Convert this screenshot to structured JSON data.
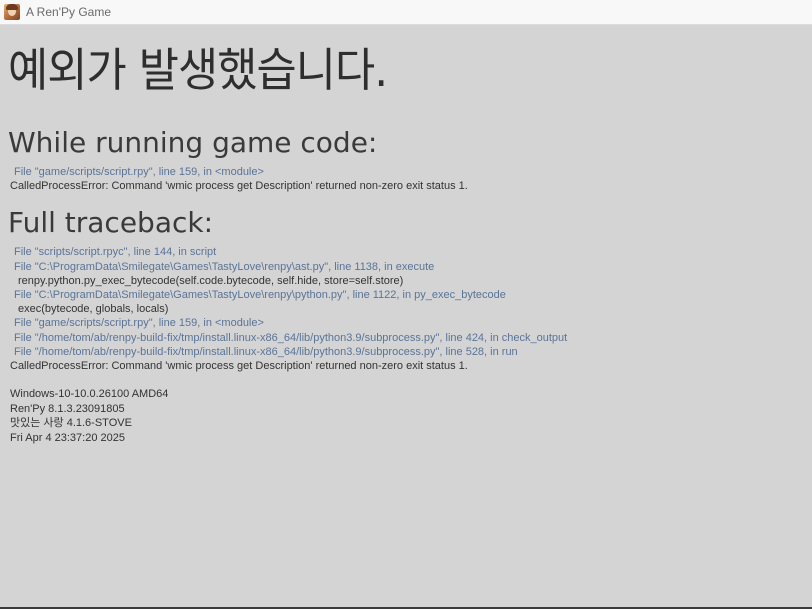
{
  "window": {
    "title": "A Ren'Py Game"
  },
  "error": {
    "heading": "예외가 발생했습니다.",
    "running_heading": "While running game code:",
    "running_lines": [
      {
        "kind": "file",
        "text": "File \"game/scripts/script.rpy\", line 159, in <module>"
      },
      {
        "kind": "msg",
        "text": "CalledProcessError: Command 'wmic process get Description' returned non-zero exit status 1."
      }
    ],
    "traceback_heading": "Full traceback:",
    "traceback_lines": [
      {
        "kind": "file",
        "text": "File \"scripts/script.rpyc\", line 144, in script"
      },
      {
        "kind": "file",
        "text": "File \"C:\\ProgramData\\Smilegate\\Games\\TastyLove\\renpy\\ast.py\", line 1138, in execute"
      },
      {
        "kind": "code",
        "text": "renpy.python.py_exec_bytecode(self.code.bytecode, self.hide, store=self.store)"
      },
      {
        "kind": "file",
        "text": "File \"C:\\ProgramData\\Smilegate\\Games\\TastyLove\\renpy\\python.py\", line 1122, in py_exec_bytecode"
      },
      {
        "kind": "code",
        "text": "exec(bytecode, globals, locals)"
      },
      {
        "kind": "file",
        "text": "File \"game/scripts/script.rpy\", line 159, in <module>"
      },
      {
        "kind": "file",
        "text": "File \"/home/tom/ab/renpy-build-fix/tmp/install.linux-x86_64/lib/python3.9/subprocess.py\", line 424, in check_output"
      },
      {
        "kind": "file",
        "text": "File \"/home/tom/ab/renpy-build-fix/tmp/install.linux-x86_64/lib/python3.9/subprocess.py\", line 528, in run"
      },
      {
        "kind": "msg",
        "text": "CalledProcessError: Command 'wmic process get Description' returned non-zero exit status 1."
      }
    ],
    "system_info": [
      "Windows-10-10.0.26100 AMD64",
      "Ren'Py 8.1.3.23091805",
      "맛있는 사랑 4.1.6-STOVE",
      "Fri Apr  4 23:37:20 2025"
    ]
  }
}
